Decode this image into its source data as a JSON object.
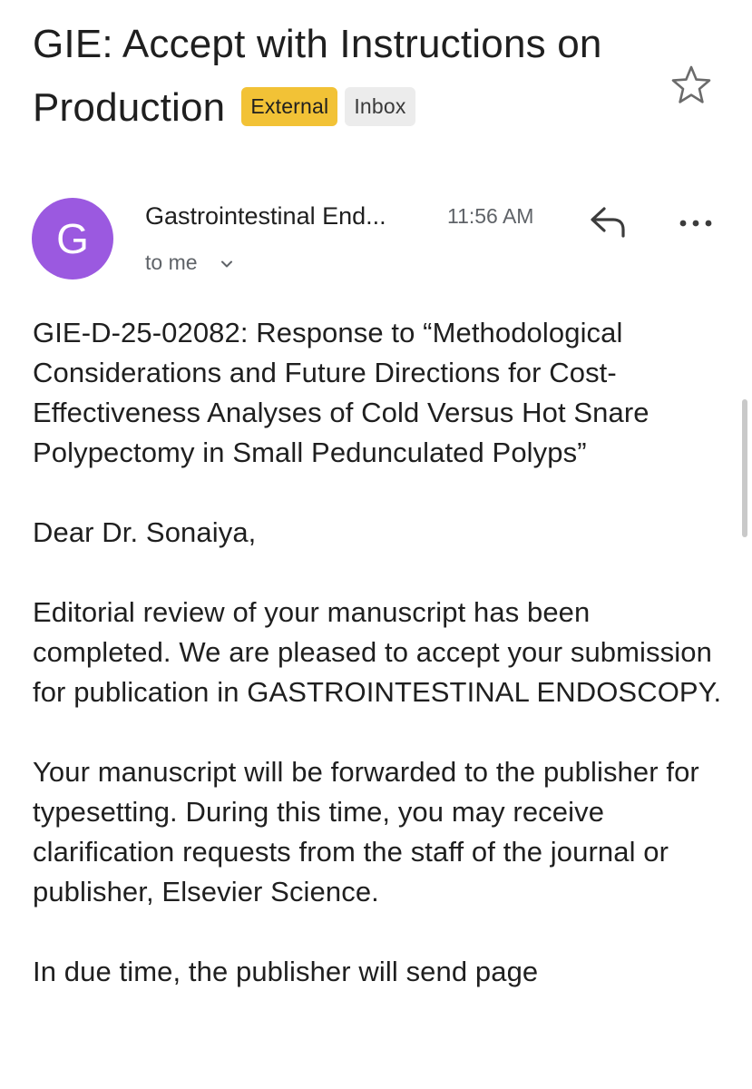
{
  "email": {
    "subject": "GIE:  Accept with Instructions on Production",
    "labels": {
      "external": "External",
      "inbox": "Inbox"
    },
    "star_icon": "star-outline-icon",
    "sender": {
      "avatar_letter": "G",
      "avatar_color": "#9b59e0",
      "name": "Gastrointestinal End...",
      "time": "11:56 AM",
      "recipient": "to me"
    },
    "actions": {
      "reply_icon": "reply-icon",
      "more_icon": "more-horizontal-icon"
    },
    "body": {
      "title_line": "GIE-D-25-02082: Response to “Methodological Considerations and Future Directions for Cost-Effectiveness Analyses of Cold Versus Hot Snare Polypectomy in Small Pedunculated Polyps”",
      "greeting": "Dear Dr. Sonaiya,",
      "para1": "Editorial review of your manuscript has been completed. We are pleased to accept your submission for publication in GASTROINTESTINAL ENDOSCOPY.",
      "para2": "Your manuscript will be forwarded to the publisher for typesetting. During this time, you may receive clarification requests from the staff of the journal or publisher, Elsevier Science.",
      "para3_partial": "In due time, the publisher will send page"
    }
  },
  "colors": {
    "external_chip": "#f2c236",
    "inbox_chip": "#ececec",
    "text": "#1f1f1f",
    "muted": "#5f6368"
  }
}
